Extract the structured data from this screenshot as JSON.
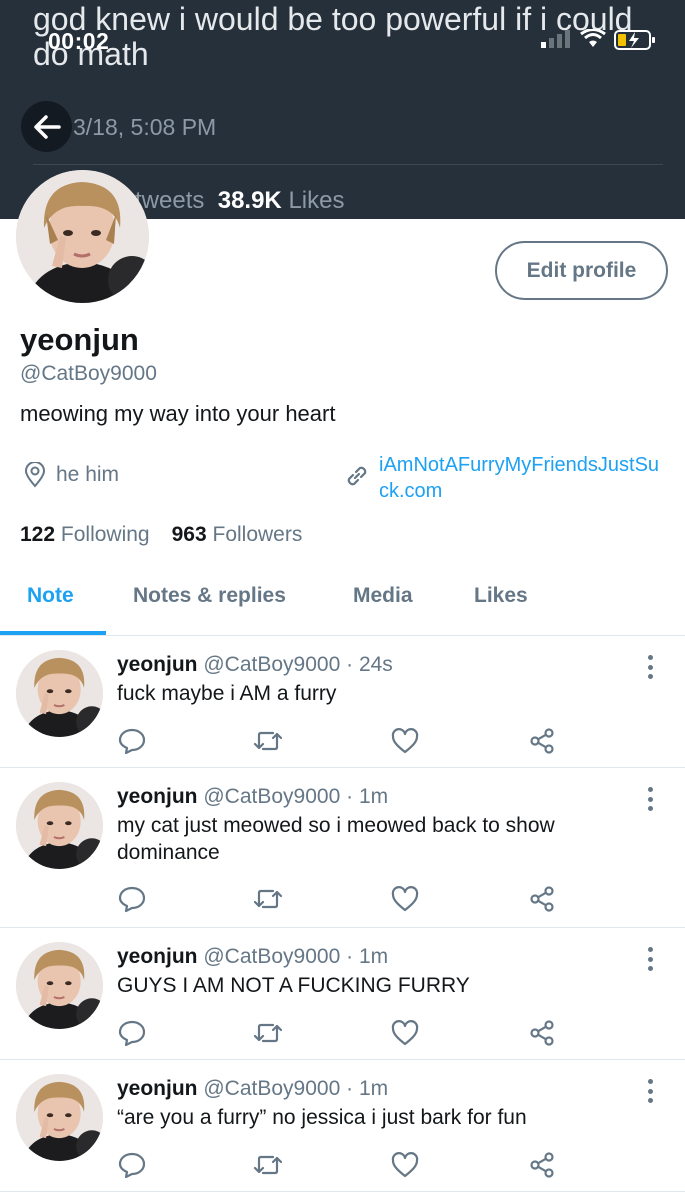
{
  "status_bar": {
    "time": "00:02"
  },
  "header": {
    "tweet_text": "god knew i would be too powerful if i could do math",
    "date": "3/18, 5:08 PM",
    "stats_tweets_label": "tweets",
    "likes_count": "38.9K",
    "likes_label": "Likes"
  },
  "profile": {
    "edit_label": "Edit profile",
    "name": "yeonjun",
    "handle": "@CatBoy9000",
    "bio": "meowing my way into your heart",
    "location": "he him",
    "website": "iAmNotAFurryMyFriendsJustSuck.com",
    "following_count": "122",
    "following_label": "Following",
    "followers_count": "963",
    "followers_label": "Followers"
  },
  "tabs": [
    {
      "label": "Note",
      "active": true
    },
    {
      "label": "Notes & replies",
      "active": false
    },
    {
      "label": "Media",
      "active": false
    },
    {
      "label": "Likes",
      "active": false
    }
  ],
  "tweets": [
    {
      "name": "yeonjun",
      "handle": "@CatBoy9000",
      "time": "24s",
      "text": "fuck maybe i AM a furry"
    },
    {
      "name": "yeonjun",
      "handle": "@CatBoy9000",
      "time": "1m",
      "text": "my cat just meowed so i meowed back to show dominance"
    },
    {
      "name": "yeonjun",
      "handle": "@CatBoy9000",
      "time": "1m",
      "text": "GUYS I AM NOT A FUCKING FURRY"
    },
    {
      "name": "yeonjun",
      "handle": "@CatBoy9000",
      "time": "1m",
      "text": "“are you a furry” no jessica i just bark for fun"
    }
  ],
  "colors": {
    "accent": "#1da1f2",
    "header_bg": "#26303b",
    "secondary_text": "#657786"
  }
}
